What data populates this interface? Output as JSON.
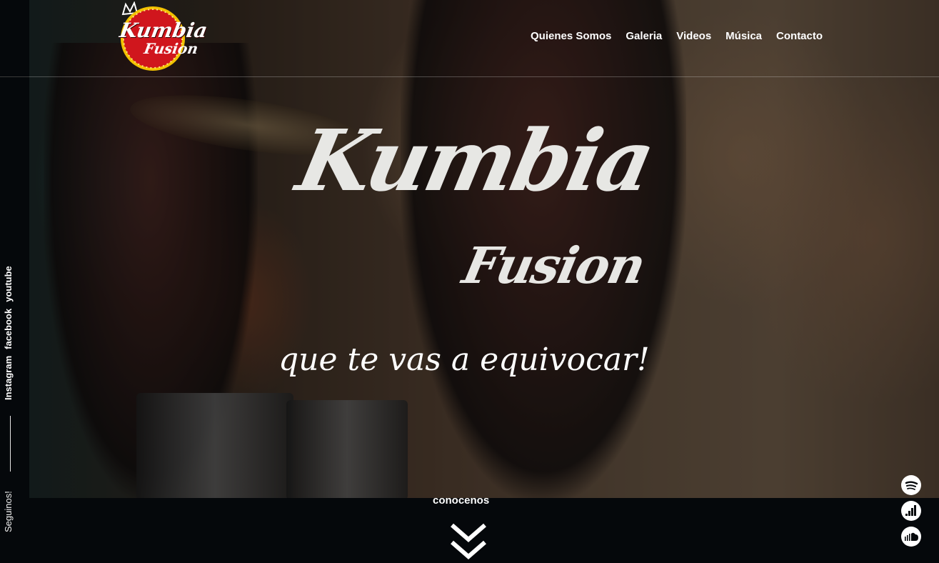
{
  "brand": {
    "logo_line1": "Kumbia",
    "logo_line2": "Fusion"
  },
  "nav": {
    "items": [
      {
        "label": "Quienes Somos"
      },
      {
        "label": "Galeria"
      },
      {
        "label": "Videos"
      },
      {
        "label": "Música"
      },
      {
        "label": "Contacto"
      }
    ]
  },
  "sidebar": {
    "social": [
      "Instagram",
      "facebook",
      "youtube"
    ],
    "follow_label": "Seguinos!"
  },
  "hero": {
    "title_line1": "Kumbia",
    "title_line2": "Fusion",
    "tagline": "que te vas a equivocar!"
  },
  "scroll": {
    "label": "conocenos"
  },
  "music_links": {
    "icons": [
      "spotify-icon",
      "deezer-icon",
      "soundcloud-icon"
    ]
  },
  "colors": {
    "background": "#05080b",
    "logo_red": "#d0161d",
    "logo_gold": "#f2c200",
    "title_white": "#e7e7e4"
  }
}
